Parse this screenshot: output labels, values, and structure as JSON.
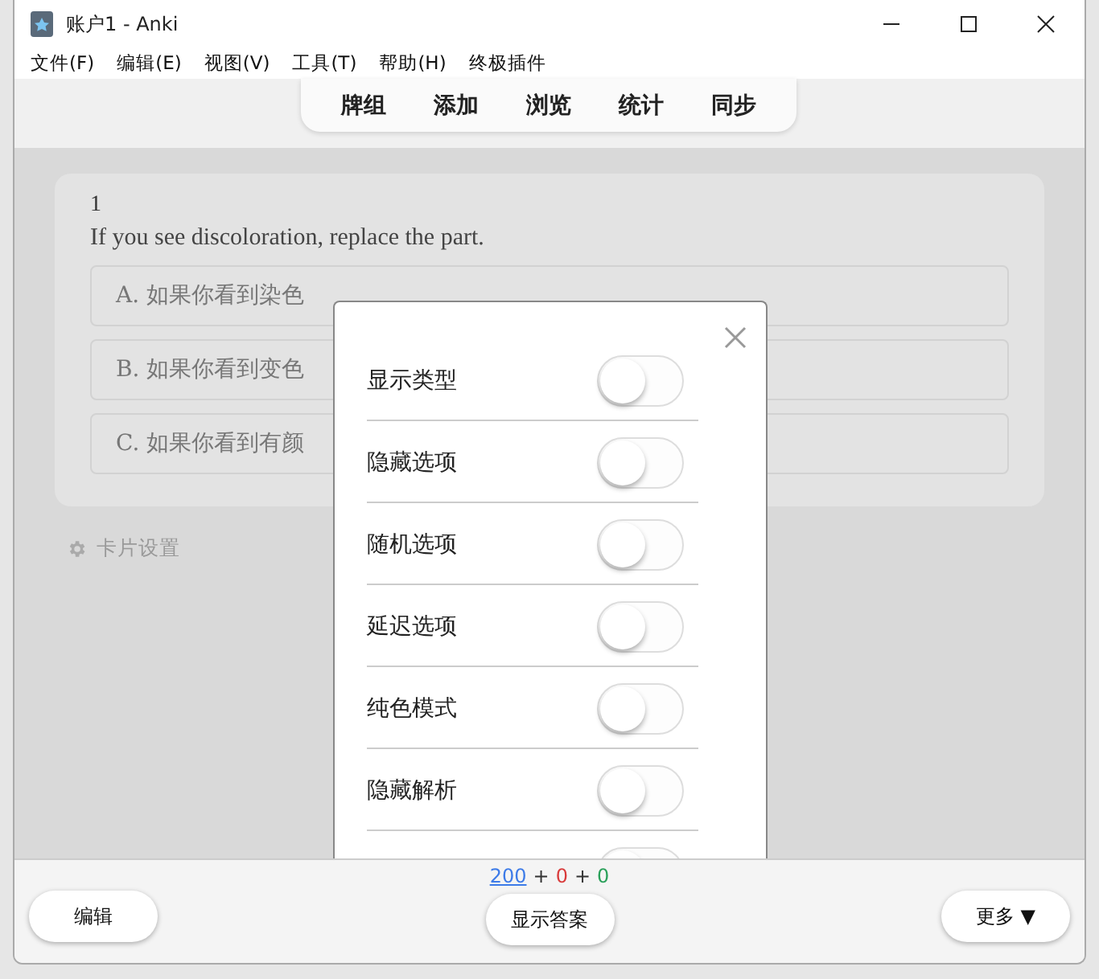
{
  "window": {
    "title": "账户1 - Anki"
  },
  "menu": [
    "文件(F)",
    "编辑(E)",
    "视图(V)",
    "工具(T)",
    "帮助(H)",
    "终极插件"
  ],
  "tabs": [
    "牌组",
    "添加",
    "浏览",
    "统计",
    "同步"
  ],
  "card": {
    "number": "1",
    "question": "If you see discoloration, replace the part.",
    "options": [
      "A. 如果你看到染色",
      "B. 如果你看到变色",
      "C. 如果你看到有颜"
    ]
  },
  "card_settings": "卡片设置",
  "dialog": {
    "toggles": [
      {
        "label": "显示类型",
        "on": false
      },
      {
        "label": "隐藏选项",
        "on": false
      },
      {
        "label": "随机选项",
        "on": false
      },
      {
        "label": "延迟选项",
        "on": false
      },
      {
        "label": "纯色模式",
        "on": false
      },
      {
        "label": "隐藏解析",
        "on": false
      },
      {
        "on": false
      }
    ]
  },
  "counts": [
    {
      "text": "200",
      "color": "#3d7be8",
      "link": true
    },
    {
      "text": "+",
      "kind": "sep"
    },
    {
      "text": "0",
      "color": "#d93b3b"
    },
    {
      "text": "+",
      "kind": "sep"
    },
    {
      "text": "0",
      "color": "#2aa05a"
    }
  ],
  "buttons": {
    "left": "编辑",
    "center": "显示答案",
    "right": "更多 ▼"
  }
}
